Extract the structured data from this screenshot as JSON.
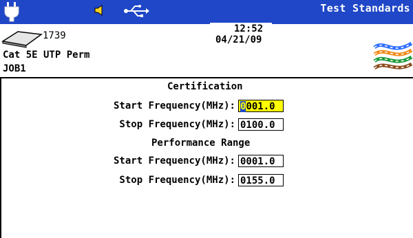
{
  "header": {
    "title": "Test Standards",
    "icons": [
      "power-plug-icon",
      "speaker-icon",
      "usb-icon"
    ]
  },
  "status": {
    "memory_count": "1739",
    "time": "12:52",
    "date": "04/21/09"
  },
  "test": {
    "cable_type": "Cat 5E UTP Perm",
    "job": "JOB1"
  },
  "colors": {
    "header_bg": "#1f47c7",
    "field_highlight": "#ffff00"
  },
  "certification": {
    "heading": "Certification",
    "start_label": "Start Frequency(MHz):",
    "start_value_first": "0",
    "start_value_rest": "001.0",
    "stop_label": "Stop Frequency(MHz):",
    "stop_value": "0100.0"
  },
  "performance": {
    "heading": "Performance Range",
    "start_label": "Start Frequency(MHz):",
    "start_value": "0001.0",
    "stop_label": "Stop Frequency(MHz):",
    "stop_value": "0155.0"
  }
}
